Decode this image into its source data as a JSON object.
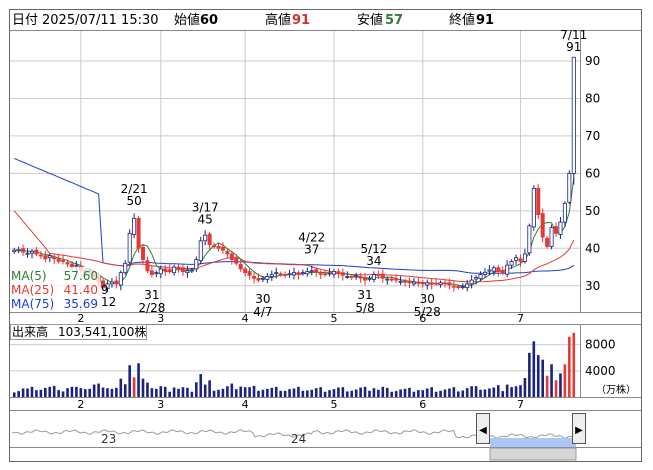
{
  "header": {
    "date_label": "日付",
    "datetime": "2025/07/11 15:30",
    "open_label": "始値",
    "open": "60",
    "high_label": "高値",
    "high": "91",
    "low_label": "安値",
    "low": "57",
    "close_label": "終値",
    "close": "91"
  },
  "colors": {
    "up": "#1a237e",
    "down": "#e53935",
    "ma5": "#2e7d32",
    "ma25": "#e53935",
    "ma75": "#1e3ecf",
    "high_value": "#d32f2f",
    "low_value": "#2e7d32",
    "volume_normal": "#1a237e",
    "volume_highlight": "#e53935",
    "frame": "#666666",
    "grid": "#cccccc"
  },
  "price_axis": {
    "ticks": [
      "90",
      "80",
      "70",
      "60",
      "50",
      "40",
      "30"
    ],
    "tick_values": [
      90,
      80,
      70,
      60,
      50,
      40,
      30
    ],
    "range": [
      23,
      98
    ]
  },
  "month_labels": [
    "2",
    "3",
    "4",
    "5",
    "6",
    "7"
  ],
  "moving_averages": [
    {
      "name": "MA(5)",
      "value": "57.60"
    },
    {
      "name": "MA(25)",
      "value": "41.40"
    },
    {
      "name": "MA(75)",
      "value": "35.69"
    }
  ],
  "annotations": [
    {
      "date": "2/21",
      "value": "50",
      "pos": "above",
      "bar": 27
    },
    {
      "date": "2/28",
      "value": "31",
      "pos": "below",
      "bar": 31
    },
    {
      "date": "3/17",
      "value": "45",
      "pos": "above",
      "bar": 43
    },
    {
      "date": "4/7",
      "value": "30",
      "pos": "below",
      "bar": 56
    },
    {
      "date": "4/22",
      "value": "37",
      "pos": "above",
      "bar": 67
    },
    {
      "date": "5/8",
      "value": "31",
      "pos": "below",
      "bar": 79
    },
    {
      "date": "5/12",
      "value": "34",
      "pos": "above",
      "bar": 81
    },
    {
      "date": "5/28",
      "value": "30",
      "pos": "below",
      "bar": 93
    },
    {
      "date": "7/11",
      "value": "91",
      "pos": "above",
      "bar": 126
    }
  ],
  "edge_labels": {
    "left_low_day": "9",
    "left_low_value": "12"
  },
  "volume": {
    "label": "出来高",
    "value": "103,541,100株",
    "ticks": [
      "8000",
      "4000"
    ],
    "tick_values": [
      8000,
      4000
    ],
    "unit": "（万株）",
    "range_max": 11000
  },
  "navigator": {
    "labels": [
      "23",
      "24"
    ],
    "left_arrow": "◀",
    "right_arrow": "▶"
  },
  "chart_data": {
    "type": "candlestick",
    "title": "",
    "x_start": "2025-01-10",
    "x_end": "2025-07-11",
    "ylim": [
      23,
      98
    ],
    "series_close": [
      39.5,
      39.6,
      39.0,
      38.7,
      39.2,
      38.5,
      38.0,
      37.2,
      38.0,
      37.2,
      36.5,
      36.5,
      35.8,
      35.0,
      35.5,
      34.2,
      33.5,
      34.0,
      32.5,
      31.0,
      29.5,
      30.5,
      31.0,
      30.5,
      33.5,
      36.0,
      44.0,
      48.0,
      40.0,
      37.0,
      34.0,
      33.0,
      33.5,
      34.5,
      34.0,
      33.8,
      35.0,
      34.5,
      33.8,
      34.0,
      34.2,
      37.0,
      42.0,
      43.5,
      41.0,
      40.5,
      40.0,
      39.5,
      38.5,
      37.0,
      36.0,
      34.5,
      33.5,
      32.8,
      32.0,
      31.5,
      32.0,
      32.5,
      33.0,
      33.5,
      33.0,
      32.8,
      33.2,
      33.5,
      33.0,
      33.5,
      33.8,
      34.0,
      33.6,
      33.2,
      33.0,
      33.4,
      33.8,
      33.2,
      32.8,
      32.5,
      32.3,
      32.6,
      32.0,
      31.5,
      32.0,
      33.0,
      32.8,
      32.0,
      31.8,
      31.6,
      31.5,
      31.2,
      31.0,
      30.8,
      31.0,
      30.6,
      30.5,
      30.8,
      30.4,
      30.6,
      30.8,
      30.5,
      30.2,
      29.8,
      29.5,
      29.8,
      30.5,
      31.5,
      32.2,
      33.0,
      33.6,
      34.2,
      34.8,
      33.8,
      33.4,
      35.5,
      36.5,
      37.5,
      36.5,
      38.5,
      46.0,
      56.0,
      49.0,
      43.0,
      40.5,
      45.5,
      44.0,
      47.0,
      52.0,
      60.0,
      91.0
    ],
    "ma5": "MA(5) 57.60",
    "ma25": "MA(25) 41.40",
    "ma75": "MA(75) 35.69",
    "volume_max_approx": 9800
  }
}
